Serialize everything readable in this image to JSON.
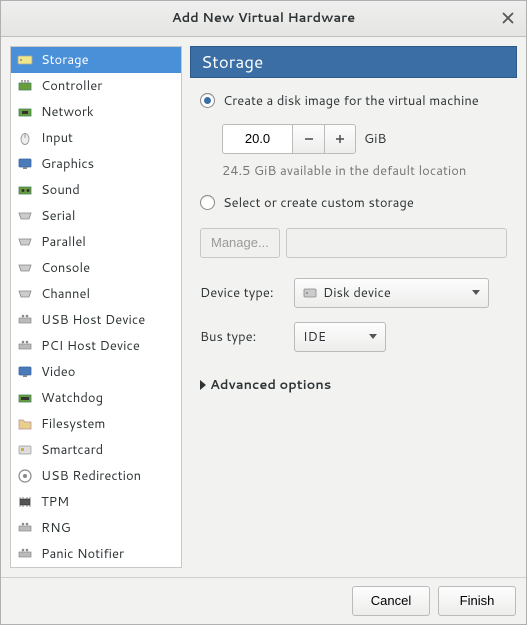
{
  "window": {
    "title": "Add New Virtual Hardware"
  },
  "sidebar": {
    "items": [
      {
        "label": "Storage"
      },
      {
        "label": "Controller"
      },
      {
        "label": "Network"
      },
      {
        "label": "Input"
      },
      {
        "label": "Graphics"
      },
      {
        "label": "Sound"
      },
      {
        "label": "Serial"
      },
      {
        "label": "Parallel"
      },
      {
        "label": "Console"
      },
      {
        "label": "Channel"
      },
      {
        "label": "USB Host Device"
      },
      {
        "label": "PCI Host Device"
      },
      {
        "label": "Video"
      },
      {
        "label": "Watchdog"
      },
      {
        "label": "Filesystem"
      },
      {
        "label": "Smartcard"
      },
      {
        "label": "USB Redirection"
      },
      {
        "label": "TPM"
      },
      {
        "label": "RNG"
      },
      {
        "label": "Panic Notifier"
      }
    ]
  },
  "content": {
    "heading": "Storage",
    "radio_create": "Create a disk image for the virtual machine",
    "size_value": "20.0",
    "size_unit": "GiB",
    "available": "24.5 GiB available in the default location",
    "radio_custom": "Select or create custom storage",
    "manage_btn": "Manage...",
    "device_type_label": "Device type:",
    "device_type_value": "Disk device",
    "bus_type_label": "Bus type:",
    "bus_type_value": "IDE",
    "advanced": "Advanced options"
  },
  "footer": {
    "cancel": "Cancel",
    "finish": "Finish"
  }
}
